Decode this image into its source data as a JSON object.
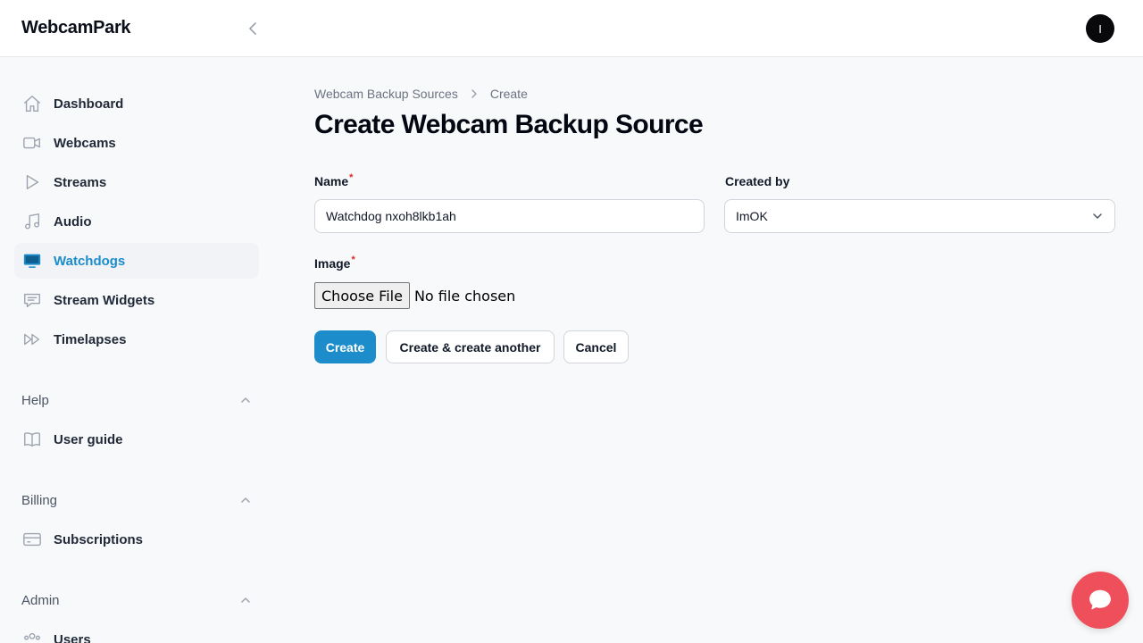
{
  "app": {
    "brand": "WebcamPark",
    "user_initial": "I"
  },
  "sidebar": {
    "items": [
      {
        "label": "Dashboard",
        "icon": "home-icon"
      },
      {
        "label": "Webcams",
        "icon": "video-camera-icon"
      },
      {
        "label": "Streams",
        "icon": "play-icon"
      },
      {
        "label": "Audio",
        "icon": "music-note-icon"
      },
      {
        "label": "Watchdogs",
        "icon": "monitor-icon",
        "active": true
      },
      {
        "label": "Stream Widgets",
        "icon": "chat-bubble-icon"
      },
      {
        "label": "Timelapses",
        "icon": "fast-forward-icon"
      }
    ],
    "groups": {
      "help": {
        "label": "Help",
        "items": [
          {
            "label": "User guide",
            "icon": "book-icon"
          }
        ]
      },
      "billing": {
        "label": "Billing",
        "items": [
          {
            "label": "Subscriptions",
            "icon": "credit-card-icon"
          }
        ]
      },
      "admin": {
        "label": "Admin",
        "items": [
          {
            "label": "Users",
            "icon": "users-icon"
          }
        ]
      }
    }
  },
  "breadcrumb": {
    "parent": "Webcam Backup Sources",
    "current": "Create"
  },
  "page": {
    "title": "Create Webcam Backup Source"
  },
  "form": {
    "name": {
      "label": "Name",
      "required_mark": "*",
      "value": "Watchdog nxoh8lkb1ah"
    },
    "created_by": {
      "label": "Created by",
      "value": "ImOK"
    },
    "image": {
      "label": "Image",
      "required_mark": "*",
      "button_label": "Choose File",
      "status": "No file chosen"
    }
  },
  "actions": {
    "create": "Create",
    "create_another": "Create & create another",
    "cancel": "Cancel"
  },
  "colors": {
    "accent": "#1c8ccb",
    "chat_fab": "#ef4f5b",
    "required": "#dc2626"
  }
}
